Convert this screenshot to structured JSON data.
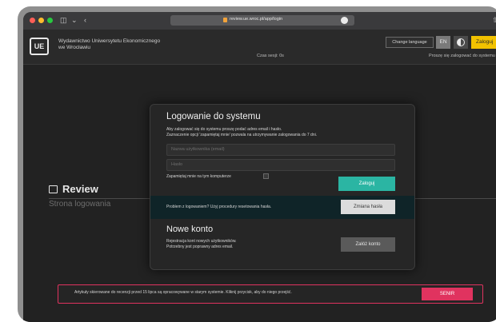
{
  "browser": {
    "url": "review.ue.wroc.pl/app/login",
    "colors": {
      "close": "#ff5f57",
      "minimize": "#febc2e",
      "maximize": "#28c840"
    }
  },
  "header": {
    "logo_text": "UE",
    "university_name_line1": "Wydawnictwo Uniwersytetu Ekonomicznego",
    "university_name_line2": "we Wrocławiu",
    "timer": "Czas sesji: 0s",
    "change_language": "Change language",
    "lang_en": "EN",
    "login_button": "Zaloguj",
    "login_hint": "Proszę się zalogować do systemu"
  },
  "page": {
    "title": "Review",
    "subtitle": "Strona logowania"
  },
  "login_modal": {
    "title": "Logowanie do systemu",
    "description_line1": "Aby zalogować się do systemu proszę podać adres email i hasło.",
    "description_line2": "Zaznaczenie opcji 'zapamiętaj mnie' pozwala na utrzymywanie zalogowania do 7 dni.",
    "email_placeholder": "Nazwa użytkownika (email)",
    "password_placeholder": "Hasło",
    "remember_label": "Zapamiętaj mnie na tym komputerze",
    "submit_label": "Zaloguj",
    "reset_text": "Problem z logowaniem? Użyj procedury resetowania hasła.",
    "reset_button": "Zmiana hasła"
  },
  "new_account": {
    "title": "Nowe konto",
    "description_line1": "Rejestracja kont nowych użytkowników.",
    "description_line2": "Potrzebny jest poprawny adres email.",
    "button": "Załóż konto"
  },
  "notice": {
    "text": "Artykuły skierowane do recenzji przed 15 lipca są opracowywane w starym systemie. Kliknij przycisk, aby do niego przejść.",
    "button": "SENIR",
    "accent": "#e0335f"
  },
  "colors": {
    "submit": "#2bb5a3",
    "login_top": "#f2c200",
    "background": "#222222"
  }
}
